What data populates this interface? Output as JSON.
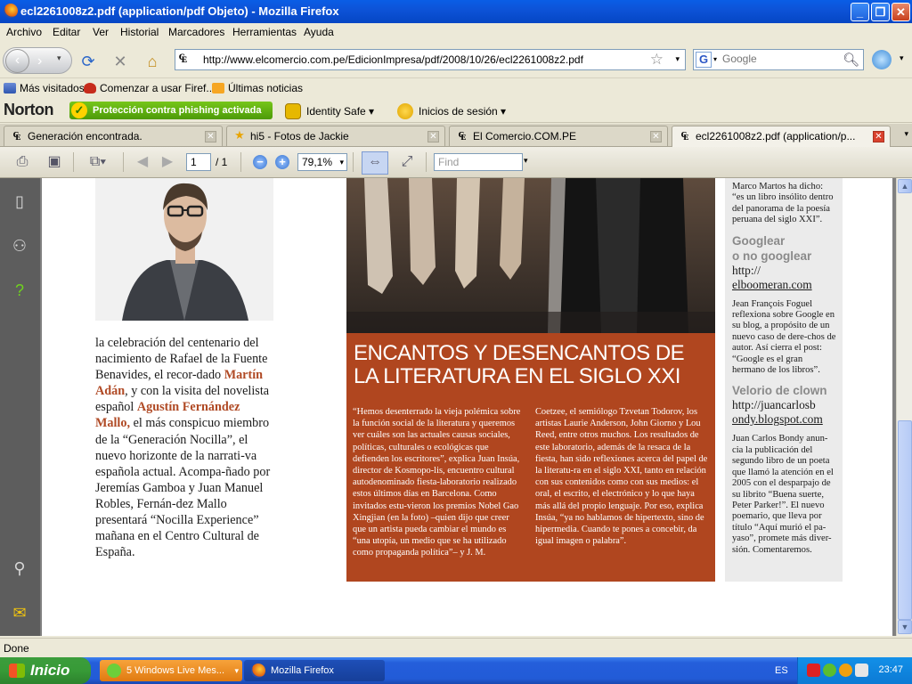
{
  "window": {
    "title": "ecl2261008z2.pdf (application/pdf Objeto) - Mozilla Firefox"
  },
  "menu": [
    "Archivo",
    "Editar",
    "Ver",
    "Historial",
    "Marcadores",
    "Herramientas",
    "Ayuda"
  ],
  "nav": {
    "url": "http://www.elcomercio.com.pe/EdicionImpresa/pdf/2008/10/26/ecl2261008z2.pdf",
    "search_placeholder": "Google"
  },
  "bookmarks": [
    "Más visitados",
    "Comenzar a usar Firef...",
    "Últimas noticias"
  ],
  "norton": {
    "logo": "Norton",
    "phishing": "Protección contra phishing activada",
    "identity": "Identity Safe",
    "logins": "Inicios de sesión"
  },
  "tabs": [
    {
      "label": "Generación encontrada.",
      "active": false
    },
    {
      "label": "hi5 - Fotos de Jackie",
      "active": false
    },
    {
      "label": "El Comercio.COM.PE",
      "active": false
    },
    {
      "label": "ecl2261008z2.pdf (application/p...",
      "active": true
    }
  ],
  "pdf_toolbar": {
    "page_current": "1",
    "page_total": "/ 1",
    "zoom": "79,1%",
    "find_placeholder": "Find"
  },
  "article": {
    "left_column": {
      "p1": "la celebración del centenario del nacimiento de Rafael de la Fuente Benavides, el recor-dado",
      "name1": "Martín Adán",
      "p2": ", y con la visita del novelista español",
      "name2": "Agustín Fernández Mallo,",
      "p3": "el más conspicuo miembro de la “Generación Nocilla”, el nuevo horizonte de la narrati-va española actual. Acompa-ñado por Jeremías Gamboa y Juan Manuel Robles, Fernán-dez Mallo presentará “Nocilla Experience” mañana  en el Centro Cultural de España."
    },
    "headline": "ENCANTOS Y DESENCANTOS DE LA LITERATURA EN EL SIGLO XXI",
    "col1": "“Hemos desenterrado la vieja polémica sobre la función social de la literatura y queremos ver cuáles son las actuales causas sociales, políticas, culturales o ecológicas que defienden los escritores”, explica Juan Insúa, director de Kosmopo-lis, encuentro cultural autodenominado fiesta-laboratorio realizado estos últimos días en Barcelona. Como invitados estu-vieron los premios Nobel Gao Xingjian (en la foto) –quien dijo que creer que un artista pueda cambiar el mundo es “una utopía, un medio que se ha utilizado como propaganda política”– y J. M.",
    "col2": "Coetzee, el semiólogo Tzvetan Todorov, los artistas Laurie Anderson, John Giorno y Lou Reed, entre otros muchos. Los resultados de este laboratorio, además de la resaca de la fiesta, han sido reflexiones acerca del papel de la literatu-ra en el siglo XXI, tanto en relación con sus contenidos como con sus medios: el oral, el escrito, el electrónico y lo que haya más allá del propio lenguaje. Por eso, explica Insúa, “ya no hablamos de hipertexto, sino de hipermedia. Cuando te pones a concebir, da igual imagen o palabra”.",
    "sidebar": {
      "top": "Marco Martos ha dicho: “es un libro insólito dentro del panorama de la poesía peruana del siglo XXI”.",
      "h1a": "Googlear",
      "h1b": "o no googlear",
      "link1a": "http://",
      "link1b": "elboomeran.com",
      "para1": "Jean François Foguel reflexiona sobre  Google en su blog, a propósito de un nuevo caso de dere-chos de autor. Así cierra el post: “Google es el gran hermano de los libros”.",
      "h2": "Velorio de clown",
      "link2a": "http://juancarlosb",
      "link2b": "ondy.blogspot.com",
      "para2": "Juan Carlos Bondy anun-cia la publicación del segundo libro de un poeta que llamó la atención en el 2005 con el desparpajo de su librito “Buena suerte, Peter Parker!”. El nuevo poemario, que lleva por título “Aquí murió el pa-yaso”, promete más diver-sión.  Comentaremos."
    }
  },
  "status": "Done",
  "taskbar": {
    "start": "Inicio",
    "task1": "5 Windows Live Mes...",
    "task2": "Mozilla Firefox",
    "lang": "ES",
    "clock": "23:47"
  },
  "colors": {
    "article_red": "#b0461f",
    "title_blue": "#0a5ee6",
    "norton_green": "#5eaf10"
  }
}
